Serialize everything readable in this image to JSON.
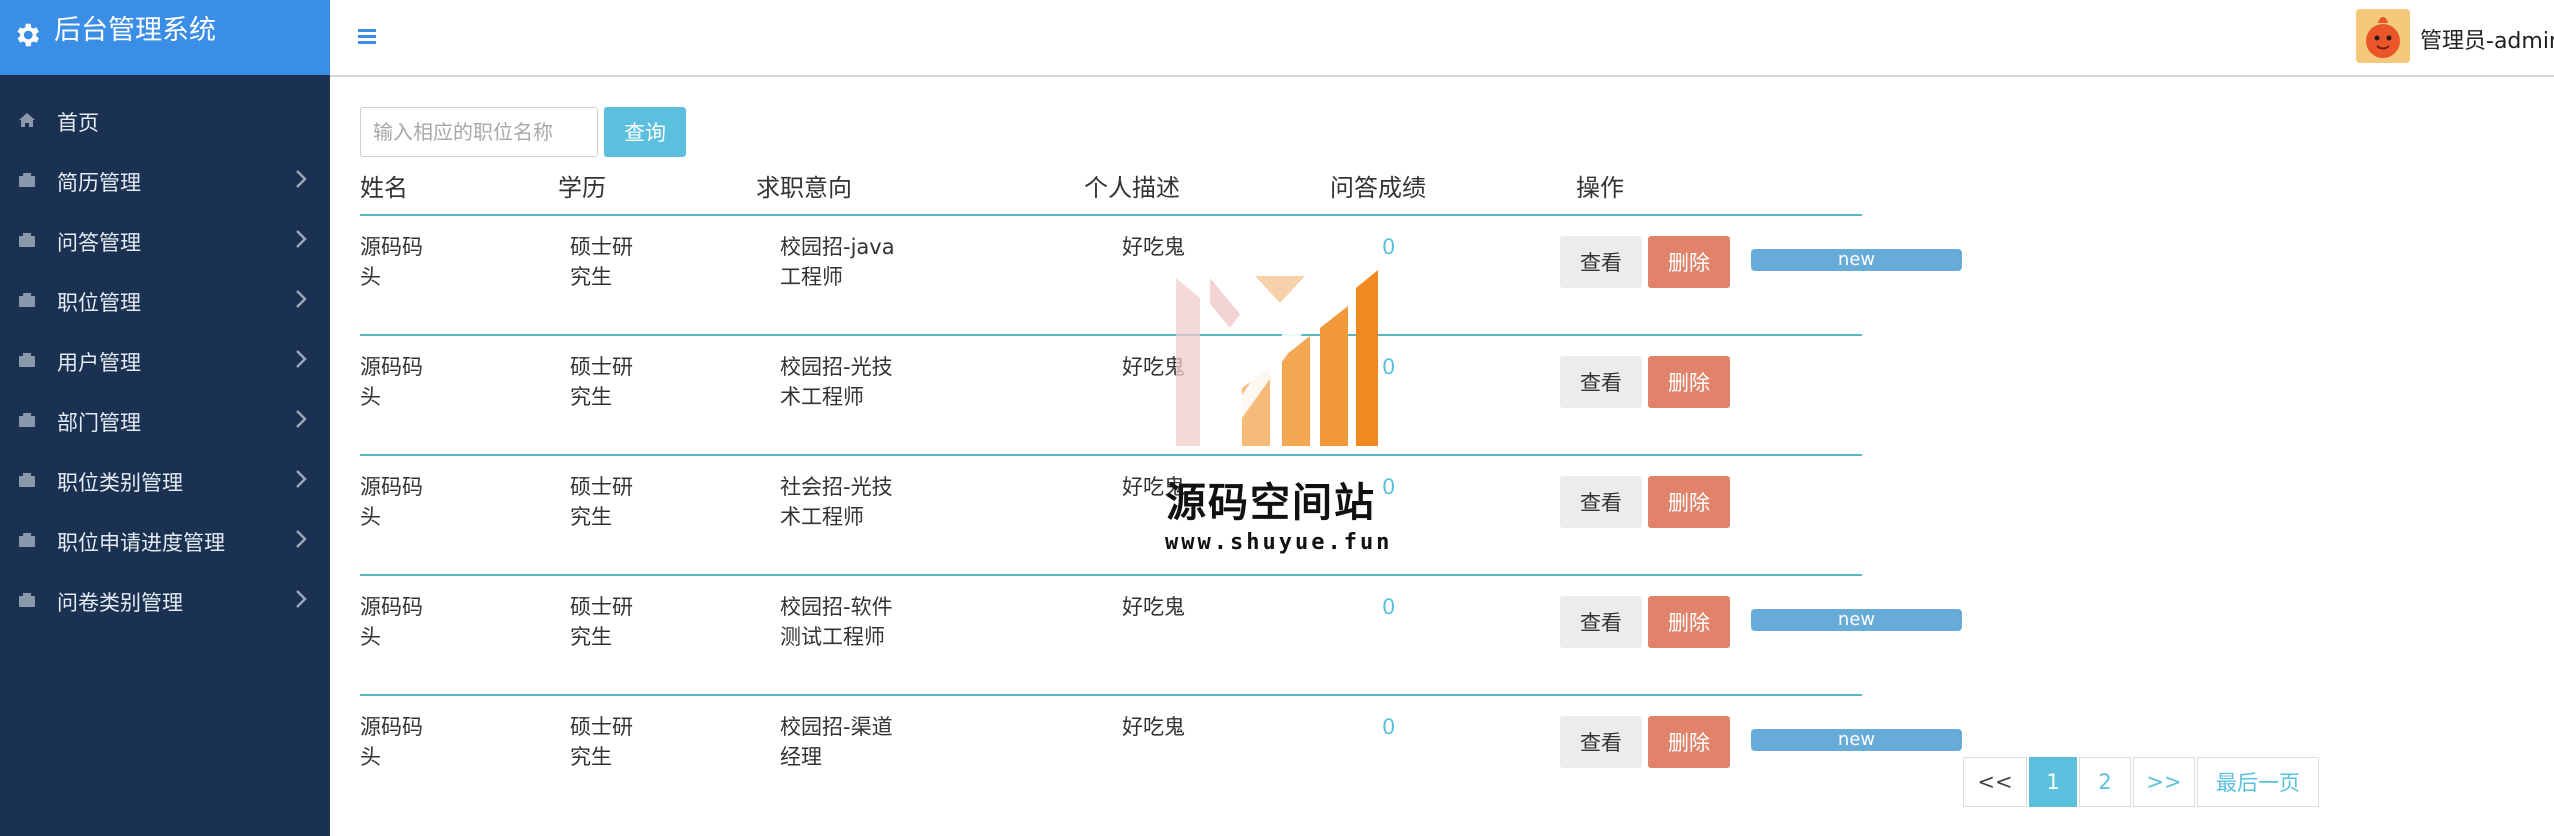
{
  "app": {
    "title": "后台管理系统",
    "brand_color": "#3a8ee6",
    "sidebar_color": "#1a3152"
  },
  "sidebar": {
    "items": [
      {
        "label": "首页",
        "icon": "home-icon",
        "has_children": false
      },
      {
        "label": "简历管理",
        "icon": "menu-icon",
        "has_children": true
      },
      {
        "label": "问答管理",
        "icon": "menu-icon",
        "has_children": true
      },
      {
        "label": "职位管理",
        "icon": "menu-icon",
        "has_children": true
      },
      {
        "label": "用户管理",
        "icon": "menu-icon",
        "has_children": true
      },
      {
        "label": "部门管理",
        "icon": "menu-icon",
        "has_children": true
      },
      {
        "label": "职位类别管理",
        "icon": "menu-icon",
        "has_children": true
      },
      {
        "label": "职位申请进度管理",
        "icon": "menu-icon",
        "has_children": true
      },
      {
        "label": "问卷类别管理",
        "icon": "menu-icon",
        "has_children": true
      }
    ]
  },
  "header": {
    "user_label": "管理员-admin"
  },
  "search": {
    "placeholder": "输入相应的职位名称",
    "button_label": "查询"
  },
  "table": {
    "columns": [
      "姓名",
      "学历",
      "求职意向",
      "个人描述",
      "问答成绩",
      "操作"
    ],
    "rows": [
      {
        "name": [
          "源码码",
          "头"
        ],
        "education": [
          "硕士研",
          "究生"
        ],
        "intention": [
          "校园招-java",
          "工程师"
        ],
        "description": "好吃鬼",
        "score": "0",
        "is_new": true
      },
      {
        "name": [
          "源码码",
          "头"
        ],
        "education": [
          "硕士研",
          "究生"
        ],
        "intention": [
          "校园招-光技",
          "术工程师"
        ],
        "description": "好吃鬼",
        "score": "0",
        "is_new": false
      },
      {
        "name": [
          "源码码",
          "头"
        ],
        "education": [
          "硕士研",
          "究生"
        ],
        "intention": [
          "社会招-光技",
          "术工程师"
        ],
        "description": "好吃鬼",
        "score": "0",
        "is_new": false
      },
      {
        "name": [
          "源码码",
          "头"
        ],
        "education": [
          "硕士研",
          "究生"
        ],
        "intention": [
          "校园招-软件",
          "测试工程师"
        ],
        "description": "好吃鬼",
        "score": "0",
        "is_new": true
      },
      {
        "name": [
          "源码码",
          "头"
        ],
        "education": [
          "硕士研",
          "究生"
        ],
        "intention": [
          "校园招-渠道",
          "经理"
        ],
        "description": "好吃鬼",
        "score": "0",
        "is_new": true
      }
    ],
    "view_label": "查看",
    "delete_label": "删除",
    "new_badge": "new"
  },
  "pagination": {
    "prev": "<<",
    "pages": [
      "1",
      "2"
    ],
    "active_page": "1",
    "next": ">>",
    "last": "最后一页"
  },
  "watermark": {
    "name": "源码空间站",
    "url": "www.shuyue.fun"
  }
}
